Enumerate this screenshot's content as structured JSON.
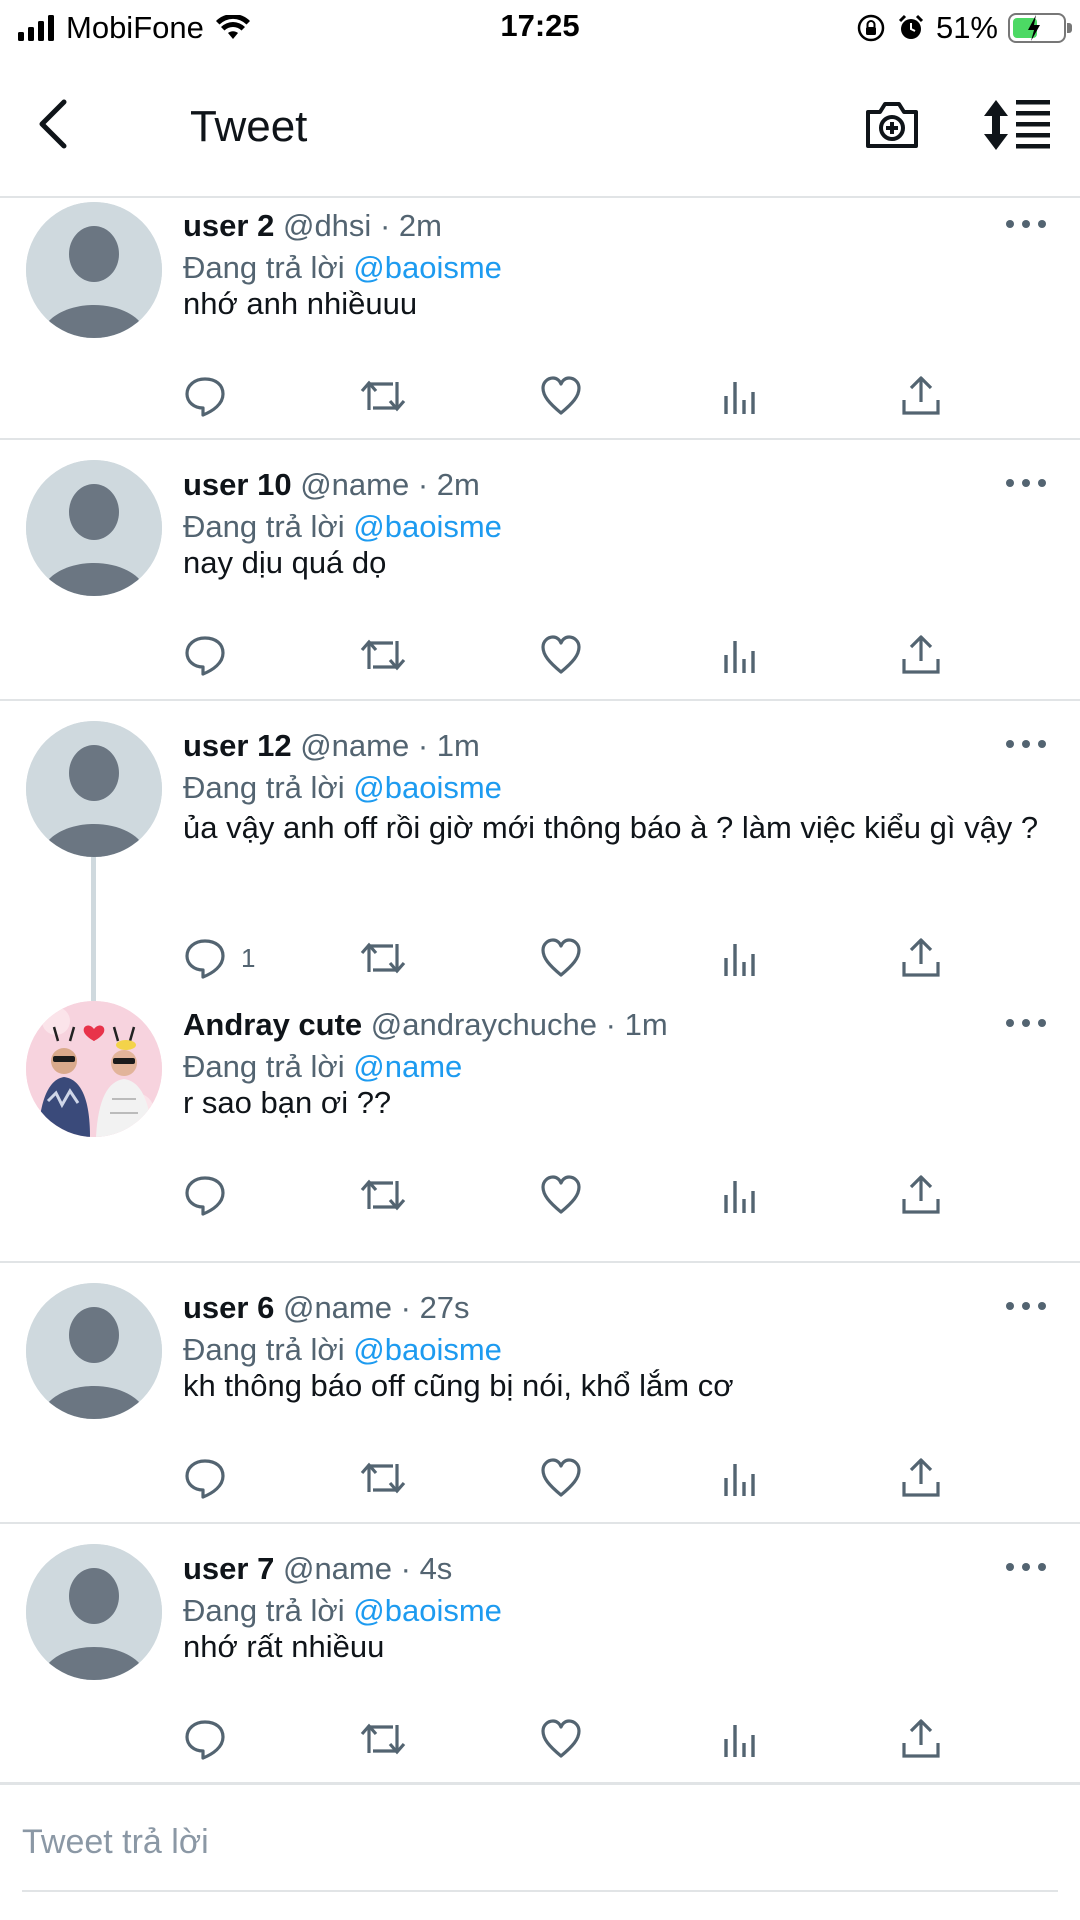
{
  "status_bar": {
    "carrier": "MobiFone",
    "time": "17:25",
    "battery_pct": "51%",
    "battery_level": 0.51
  },
  "header": {
    "title": "Tweet",
    "icons": [
      "back-arrow-icon",
      "camera-add-icon",
      "sort-icon"
    ]
  },
  "tweets": [
    {
      "name": "user 2",
      "handle": "@dhsi",
      "dot": "·",
      "time": "2m",
      "reply_prefix": "Đang trả lời",
      "reply_to": "@baoisme",
      "text": "nhớ anh nhiềuuu",
      "reply_count": ""
    },
    {
      "name": "user 10",
      "handle": "@name",
      "dot": "·",
      "time": "2m",
      "reply_prefix": "Đang trả lời",
      "reply_to": "@baoisme",
      "text": "nay dịu quá dọ",
      "reply_count": ""
    },
    {
      "name": "user 12",
      "handle": "@name",
      "dot": "·",
      "time": "1m",
      "reply_prefix": "Đang trả lời",
      "reply_to": "@baoisme",
      "text": "ủa vậy anh off rồi giờ mới thông báo à ? làm việc kiểu gì vậy ?",
      "reply_count": "1"
    },
    {
      "name": "Andray cute",
      "handle": "@andraychuche",
      "dot": "·",
      "time": "1m",
      "reply_prefix": "Đang trả lời",
      "reply_to": "@name",
      "text": "r sao bạn ơi ??",
      "reply_count": ""
    },
    {
      "name": "user 6",
      "handle": "@name",
      "dot": "·",
      "time": "27s",
      "reply_prefix": "Đang trả lời",
      "reply_to": "@baoisme",
      "text": "kh thông báo off cũng bị nói, khổ lắm cơ",
      "reply_count": ""
    },
    {
      "name": "user 7",
      "handle": "@name",
      "dot": "·",
      "time": "4s",
      "reply_prefix": "Đang trả lời",
      "reply_to": "@baoisme",
      "text": "nhớ rất nhiềuu",
      "reply_count": ""
    }
  ],
  "reply_bar": {
    "placeholder": "Tweet trả lời"
  },
  "colors": {
    "link": "#1d9bf0",
    "muted": "#536471",
    "text": "#0f1419",
    "divider": "#e1e4e6",
    "avatar_placeholder": "#cfd9de",
    "battery_fill": "#4cd964"
  }
}
